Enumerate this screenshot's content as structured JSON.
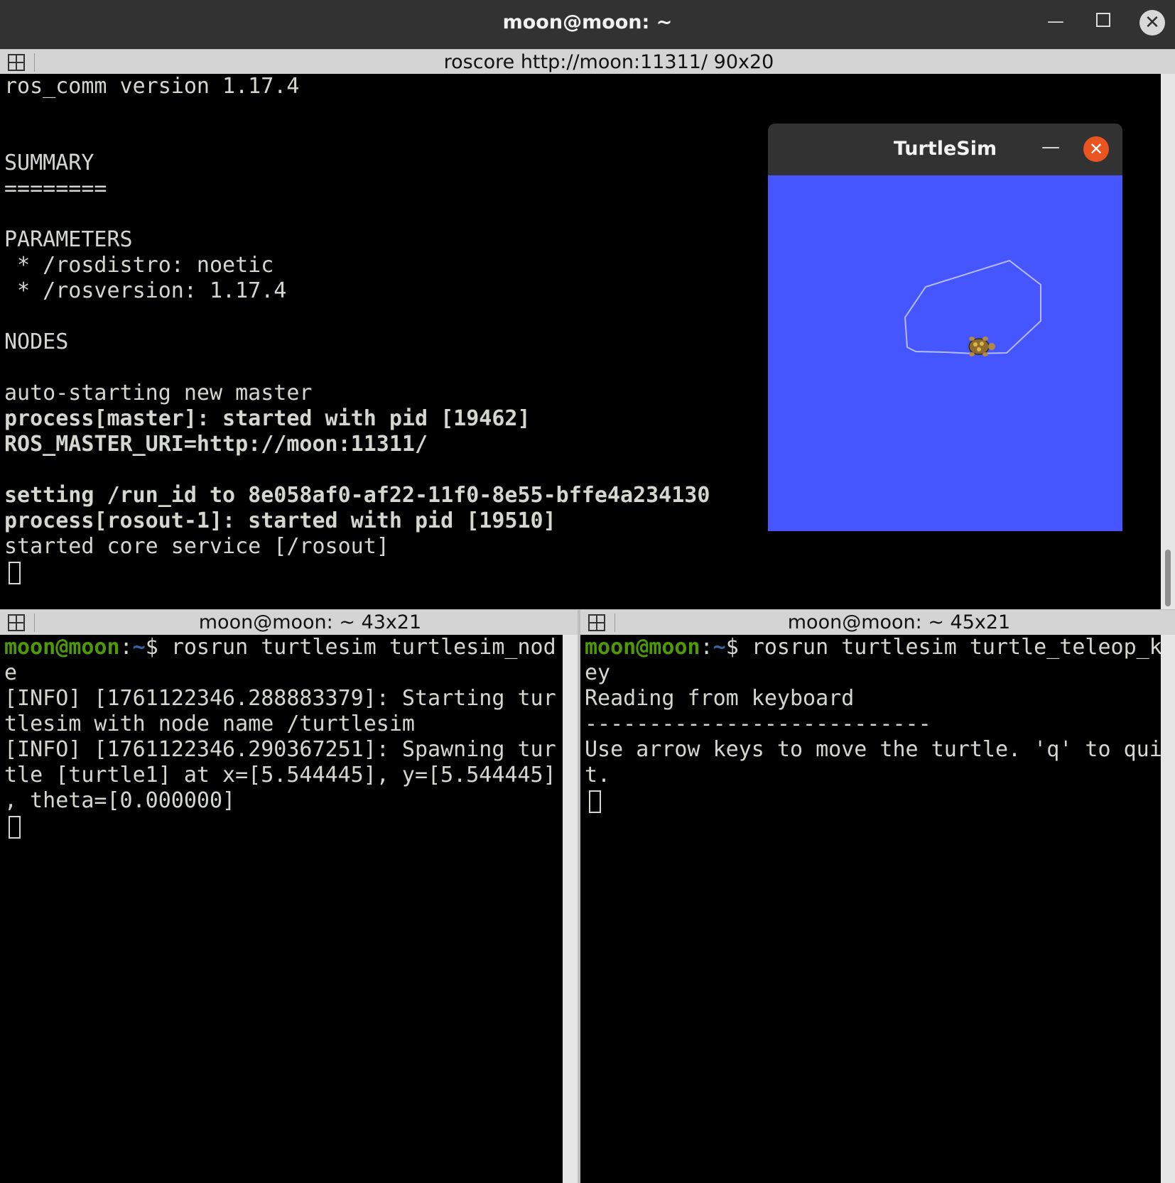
{
  "window": {
    "title": "moon@moon: ~",
    "minimize_glyph": "—",
    "close_glyph": "✕"
  },
  "panes": {
    "top": {
      "header": "roscore http://moon:11311/ 90x20",
      "lines": [
        "ros_comm version 1.17.4",
        "",
        "",
        "SUMMARY",
        "========",
        "",
        "PARAMETERS",
        " * /rosdistro: noetic",
        " * /rosversion: 1.17.4",
        "",
        "NODES",
        "",
        "auto-starting new master",
        "process[master]: started with pid [19462]",
        "ROS_MASTER_URI=http://moon:11311/",
        "",
        "setting /run_id to 8e058af0-af22-11f0-8e55-bffe4a234130",
        "process[rosout-1]: started with pid [19510]",
        "started core service [/rosout]"
      ]
    },
    "bottom_left": {
      "header": "moon@moon: ~ 43x21",
      "prompt_user": "moon@moon",
      "prompt_sep": ":",
      "prompt_path": "~",
      "prompt_dollar": "$ ",
      "command": "rosrun turtlesim turtlesim_nod",
      "lines": [
        "e",
        "[INFO] [1761122346.288883379]: Starting tur",
        "tlesim with node name /turtlesim",
        "[INFO] [1761122346.290367251]: Spawning tur",
        "tle [turtle1] at x=[5.544445], y=[5.544445]",
        ", theta=[0.000000]"
      ]
    },
    "bottom_right": {
      "header": "moon@moon: ~ 45x21",
      "prompt_user": "moon@moon",
      "prompt_sep": ":",
      "prompt_path": "~",
      "prompt_dollar": "$ ",
      "command": "rosrun turtlesim turtle_teleop_k",
      "lines": [
        "ey",
        "Reading from keyboard",
        "---------------------------",
        "Use arrow keys to move the turtle. 'q' to qui",
        "t."
      ]
    }
  },
  "turtlesim": {
    "title": "TurtleSim",
    "minimize_glyph": "—",
    "close_glyph": "✕",
    "background": "#4556ff",
    "trail_color": "#b3bcff"
  },
  "colors": {
    "prompt_user": "#4e9a06",
    "prompt_path": "#3465a4",
    "terminal_text": "#d3d7cf",
    "close_accent": "#e95420"
  }
}
